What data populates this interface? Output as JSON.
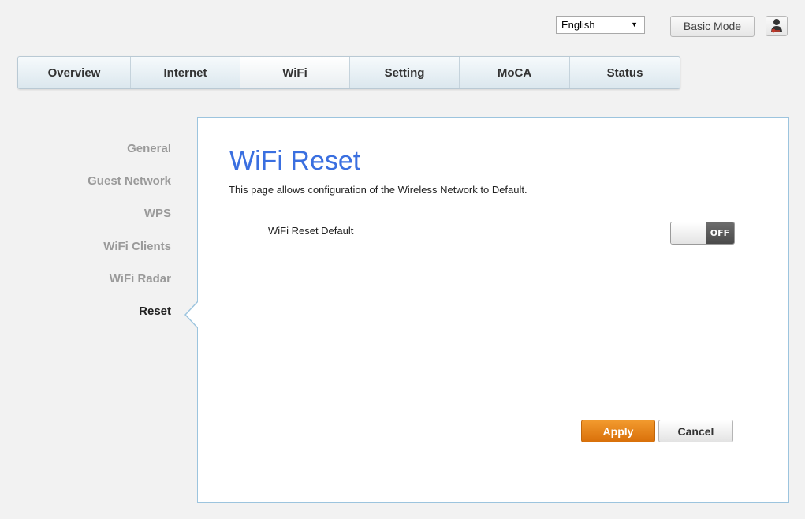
{
  "header": {
    "language": "English",
    "mode_button": "Basic Mode",
    "user_icon": "user-key-icon"
  },
  "nav": {
    "tabs": [
      {
        "label": "Overview"
      },
      {
        "label": "Internet"
      },
      {
        "label": "WiFi"
      },
      {
        "label": "Setting"
      },
      {
        "label": "MoCA"
      },
      {
        "label": "Status"
      }
    ],
    "active": "WiFi"
  },
  "sidebar": {
    "items": [
      {
        "label": "General"
      },
      {
        "label": "Guest Network"
      },
      {
        "label": "WPS"
      },
      {
        "label": "WiFi Clients"
      },
      {
        "label": "WiFi Radar"
      },
      {
        "label": "Reset"
      }
    ],
    "active": "Reset"
  },
  "main": {
    "title": "WiFi Reset",
    "description": "This page allows configuration of the Wireless Network to Default.",
    "field_label": "WiFi Reset Default",
    "toggle_state": "OFF",
    "apply_label": "Apply",
    "cancel_label": "Cancel"
  },
  "colors": {
    "title": "#3a6fe0",
    "apply": "#e8860f",
    "panel_border": "#9cc4de"
  }
}
